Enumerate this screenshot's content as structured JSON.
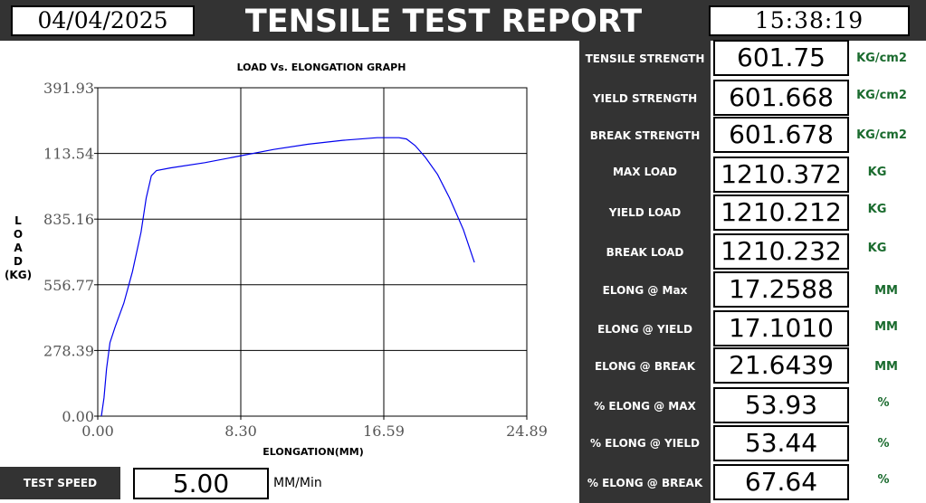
{
  "header": {
    "date": "04/04/2025",
    "title": "TENSILE TEST REPORT",
    "time": "15:38:19"
  },
  "chart_data": {
    "type": "line",
    "title": "LOAD Vs. ELONGATION GRAPH",
    "xlabel": "ELONGATION(MM)",
    "ylabel": "L\nO\nA\nD\n(KG)",
    "xlim": [
      0,
      24.89
    ],
    "x_ticks": [
      "0.00",
      "8.30",
      "16.59",
      "24.89"
    ],
    "y_ticks": [
      "0.00",
      "278.39",
      "556.77",
      "835.16",
      "113.54",
      "391.93"
    ],
    "grid": true,
    "color": "#0000ee",
    "series": [
      {
        "x": [
          0.0,
          0.15,
          0.3,
          0.5,
          0.8,
          1.3,
          1.8,
          2.3,
          2.6,
          2.9,
          3.2,
          4.0,
          6.0,
          8.0,
          10.0,
          12.0,
          14.0,
          16.0,
          17.26,
          17.7,
          18.2,
          18.8,
          19.5,
          20.2,
          21.0,
          21.64
        ],
        "y_frac": [
          0.0,
          0.07,
          0.18,
          0.28,
          0.34,
          0.43,
          0.55,
          0.7,
          0.83,
          0.915,
          0.935,
          0.945,
          0.965,
          0.99,
          1.015,
          1.035,
          1.05,
          1.06,
          1.06,
          1.055,
          1.03,
          0.985,
          0.92,
          0.83,
          0.71,
          0.585
        ]
      }
    ]
  },
  "results": [
    {
      "label": "TENSILE STRENGTH",
      "value": "601.75",
      "unit": "KG/cm2"
    },
    {
      "label": "YIELD STRENGTH",
      "value": "601.668",
      "unit": "KG/cm2"
    },
    {
      "label": "BREAK STRENGTH",
      "value": "601.678",
      "unit": "KG/cm2"
    },
    {
      "label": "MAX LOAD",
      "value": "1210.372",
      "unit": "KG"
    },
    {
      "label": "YIELD LOAD",
      "value": "1210.212",
      "unit": "KG"
    },
    {
      "label": "BREAK LOAD",
      "value": "1210.232",
      "unit": "KG"
    },
    {
      "label": "ELONG @ Max",
      "value": "17.2588",
      "unit": "MM"
    },
    {
      "label": "ELONG @ YIELD",
      "value": "17.1010",
      "unit": "MM"
    },
    {
      "label": "ELONG @ BREAK",
      "value": "21.6439",
      "unit": "MM"
    },
    {
      "label": "% ELONG @ MAX",
      "value": "53.93",
      "unit": "%"
    },
    {
      "label": "% ELONG @ YIELD",
      "value": "53.44",
      "unit": "%"
    },
    {
      "label": "% ELONG @ BREAK",
      "value": "67.64",
      "unit": "%"
    }
  ],
  "test_speed": {
    "label": "TEST SPEED",
    "value": "5.00",
    "unit": "MM/Min"
  }
}
